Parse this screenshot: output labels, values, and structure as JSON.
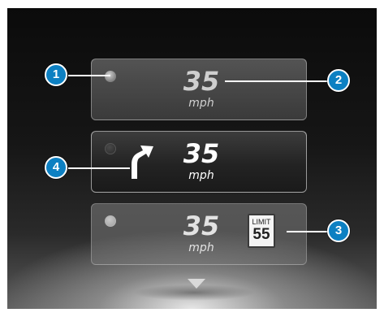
{
  "colors": {
    "callout_blue": "#0d80c2",
    "callout_border": "#ffffff",
    "display_background": "#111111"
  },
  "cards": [
    {
      "id": "card-1",
      "speed": "35",
      "unit": "mph",
      "state": "dimmed",
      "icon": "indicator-dot"
    },
    {
      "id": "card-2",
      "speed": "35",
      "unit": "mph",
      "state": "active",
      "icon": "turn-right-arrow-icon"
    },
    {
      "id": "card-3",
      "speed": "35",
      "unit": "mph",
      "state": "faded",
      "limit_sign": {
        "label": "LIMIT",
        "value": "55"
      }
    }
  ],
  "scroll_icon": "chevron-down-icon",
  "callouts": [
    {
      "number": "1",
      "target": "indicator-dot"
    },
    {
      "number": "2",
      "target": "speed-value"
    },
    {
      "number": "3",
      "target": "speed-limit-sign"
    },
    {
      "number": "4",
      "target": "turn-arrow"
    }
  ]
}
